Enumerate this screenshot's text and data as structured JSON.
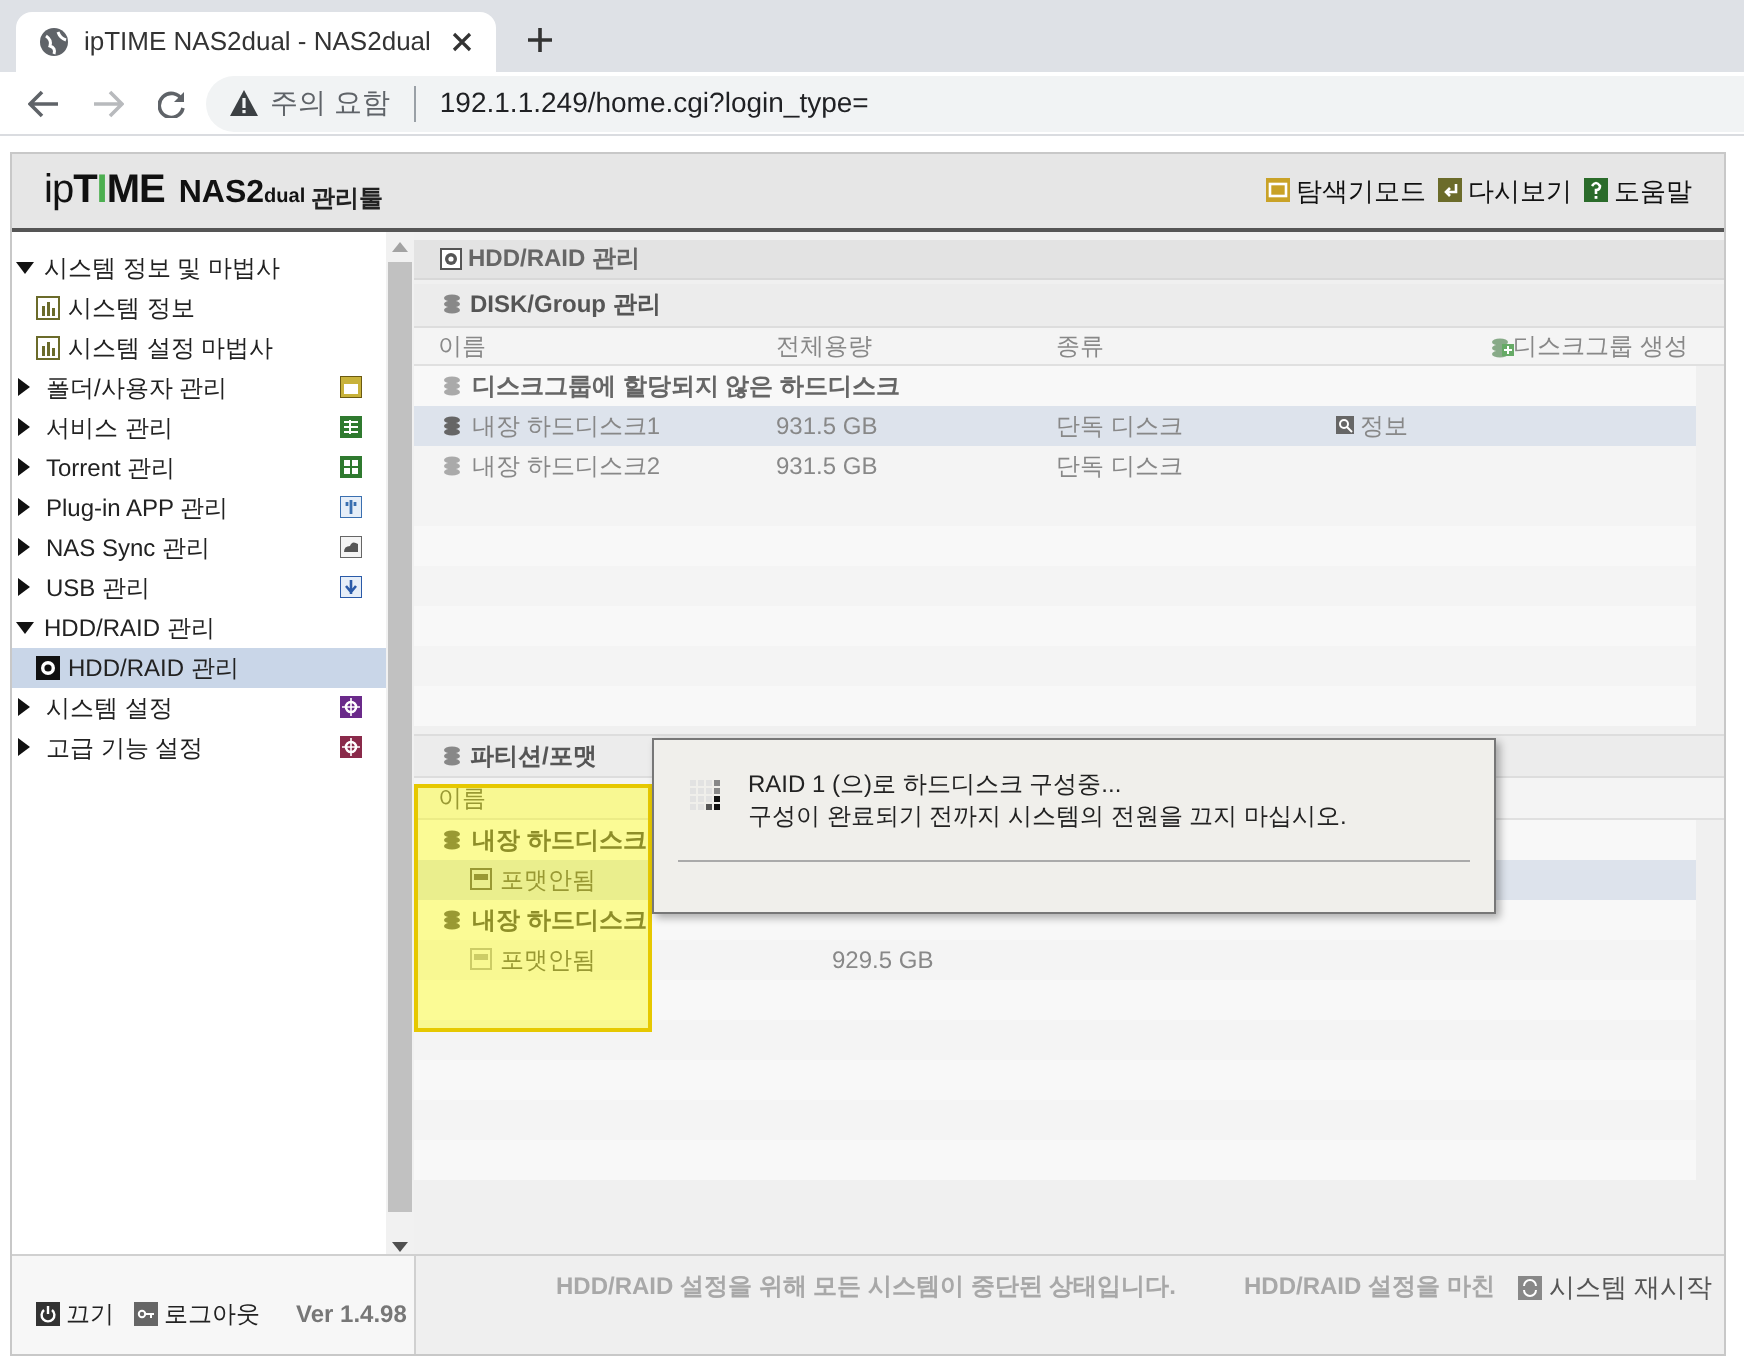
{
  "browser": {
    "tab_title": "ipTIME NAS2dual - NAS2dual",
    "security_label": "주의 요함",
    "url": "192.1.1.249/home.cgi?login_type="
  },
  "header": {
    "brand": "ipTIME",
    "model": "NAS2",
    "model_suffix": "dual",
    "tool": "관리툴",
    "links": [
      "탐색기모드",
      "다시보기",
      "도움말"
    ]
  },
  "sidebar": {
    "items": [
      {
        "label": "시스템 정보 및 마법사",
        "expanded": true,
        "selected": false,
        "children": [
          {
            "label": "시스템 정보",
            "selected": false
          },
          {
            "label": "시스템 설정 마법사",
            "selected": false
          }
        ]
      },
      {
        "label": "폴더/사용자 관리",
        "expanded": false,
        "selected": false
      },
      {
        "label": "서비스 관리",
        "expanded": false,
        "selected": false
      },
      {
        "label": "Torrent 관리",
        "expanded": false,
        "selected": false
      },
      {
        "label": "Plug-in APP 관리",
        "expanded": false,
        "selected": false
      },
      {
        "label": "NAS Sync 관리",
        "expanded": false,
        "selected": false
      },
      {
        "label": "USB 관리",
        "expanded": false,
        "selected": false
      },
      {
        "label": "HDD/RAID 관리",
        "expanded": true,
        "selected": false,
        "children": [
          {
            "label": "HDD/RAID 관리",
            "selected": true
          }
        ]
      },
      {
        "label": "시스템 설정",
        "expanded": false,
        "selected": false
      },
      {
        "label": "고급 기능 설정",
        "expanded": false,
        "selected": false
      }
    ]
  },
  "panel_title": "HDD/RAID 관리",
  "disk_group": {
    "title": "DISK/Group 관리",
    "columns": [
      "이름",
      "전체용량",
      "종류"
    ],
    "create_label": "디스크그룹 생성",
    "group": "디스크그룹에 할당되지 않은 하드디스크",
    "rows": [
      {
        "name": "내장 하드디스크1",
        "capacity": "931.5 GB",
        "type": "단독 디스크",
        "info": "정보",
        "selected": true
      },
      {
        "name": "내장 하드디스크2",
        "capacity": "931.5 GB",
        "type": "단독 디스크",
        "selected": false
      }
    ]
  },
  "partition": {
    "title": "파티션/포맷",
    "columns": [
      "이름"
    ],
    "disks": [
      {
        "name": "내장 하드디스크",
        "children": [
          {
            "name": "포맷안됨",
            "selected": true
          }
        ]
      },
      {
        "name": "내장 하드디스크",
        "children": [
          {
            "name": "포맷안됨",
            "capacity": "929.5 GB",
            "selected": false
          }
        ]
      }
    ]
  },
  "dialog": {
    "lines": [
      "RAID 1 (으)로 하드디스크 구성중...",
      "구성이 완료되기 전까지 시스템의 전원을 끄지 마십시오."
    ]
  },
  "footer": {
    "power": "끄기",
    "logout": "로그아웃",
    "version": "Ver 1.4.98",
    "messages": [
      "HDD/RAID 설정을 위해 모든 시스템이 중단된 상태입니다.",
      "HDD/RAID 설정을 마친"
    ],
    "restart": "시스템 재시작"
  }
}
